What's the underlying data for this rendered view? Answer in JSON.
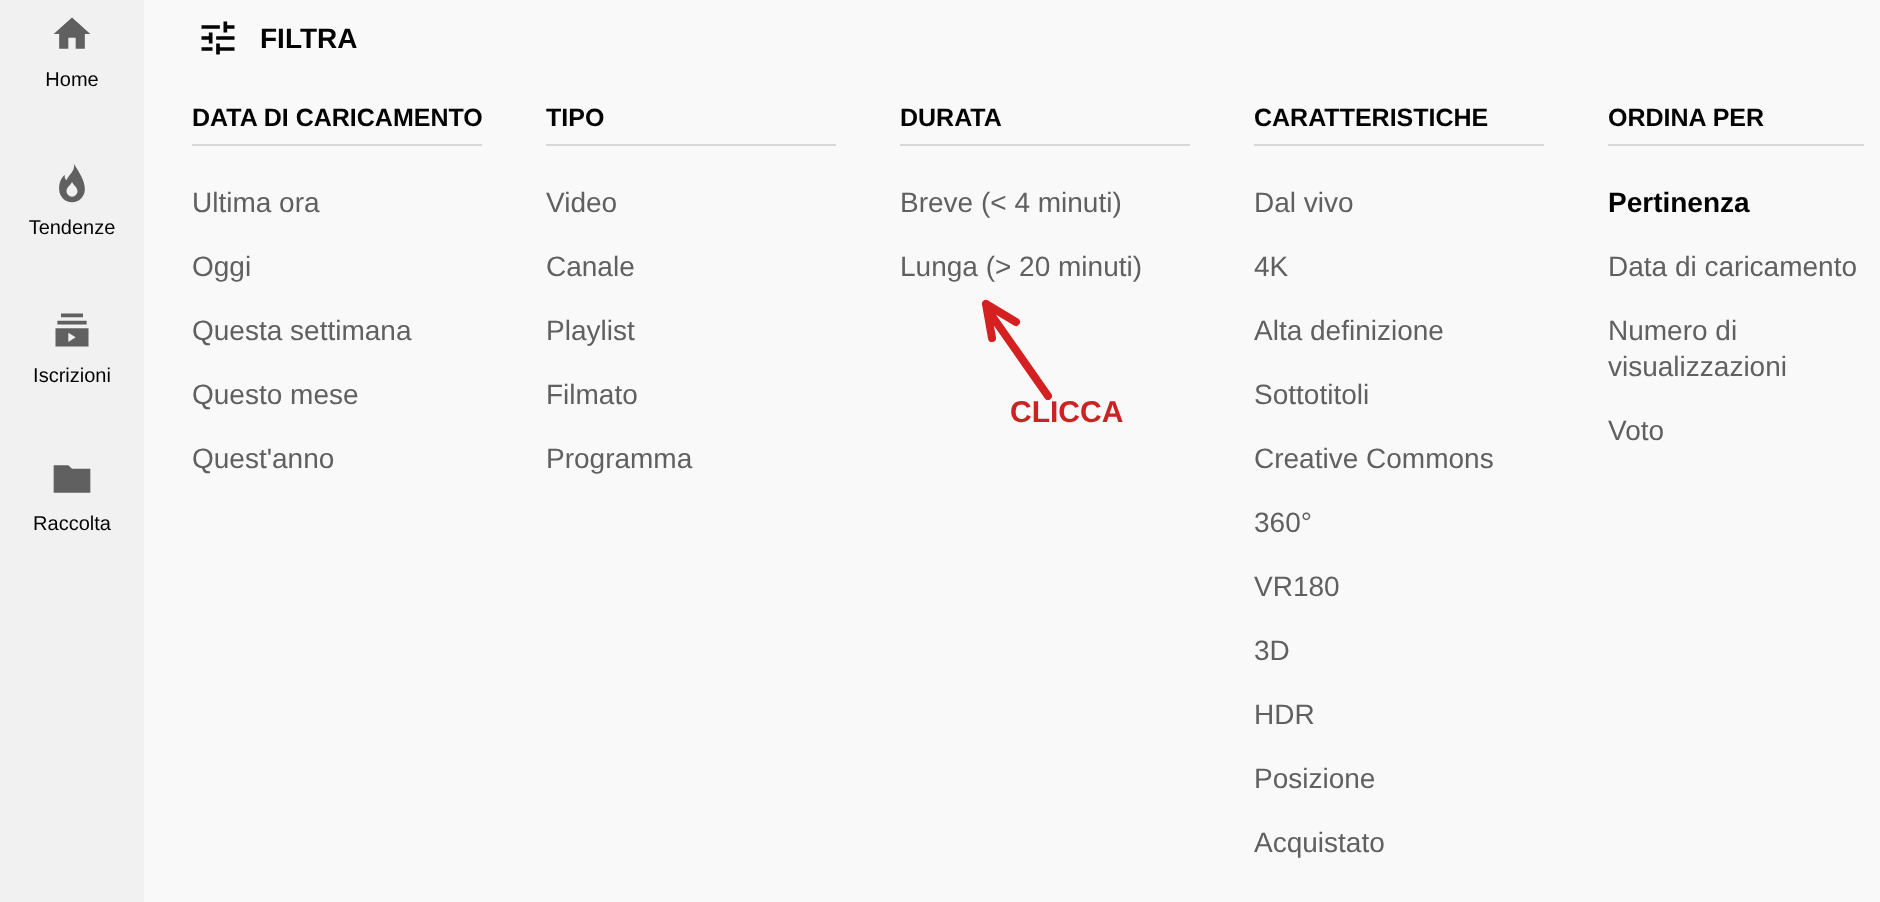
{
  "sidebar": {
    "items": [
      {
        "label": "Home"
      },
      {
        "label": "Tendenze"
      },
      {
        "label": "Iscrizioni"
      },
      {
        "label": "Raccolta"
      }
    ]
  },
  "header": {
    "title": "FILTRA"
  },
  "filter_groups": [
    {
      "heading": "DATA DI CARICAMENTO",
      "options": [
        {
          "label": "Ultima ora",
          "selected": false
        },
        {
          "label": "Oggi",
          "selected": false
        },
        {
          "label": "Questa settimana",
          "selected": false
        },
        {
          "label": "Questo mese",
          "selected": false
        },
        {
          "label": "Quest'anno",
          "selected": false
        }
      ]
    },
    {
      "heading": "TIPO",
      "options": [
        {
          "label": "Video",
          "selected": false
        },
        {
          "label": "Canale",
          "selected": false
        },
        {
          "label": "Playlist",
          "selected": false
        },
        {
          "label": "Filmato",
          "selected": false
        },
        {
          "label": "Programma",
          "selected": false
        }
      ]
    },
    {
      "heading": "DURATA",
      "options": [
        {
          "label": "Breve (< 4 minuti)",
          "selected": false
        },
        {
          "label": "Lunga (> 20 minuti)",
          "selected": false
        }
      ]
    },
    {
      "heading": "CARATTERISTICHE",
      "options": [
        {
          "label": "Dal vivo",
          "selected": false
        },
        {
          "label": "4K",
          "selected": false
        },
        {
          "label": "Alta definizione",
          "selected": false
        },
        {
          "label": "Sottotitoli",
          "selected": false
        },
        {
          "label": "Creative Commons",
          "selected": false
        },
        {
          "label": "360°",
          "selected": false
        },
        {
          "label": "VR180",
          "selected": false
        },
        {
          "label": "3D",
          "selected": false
        },
        {
          "label": "HDR",
          "selected": false
        },
        {
          "label": "Posizione",
          "selected": false
        },
        {
          "label": "Acquistato",
          "selected": false
        }
      ]
    },
    {
      "heading": "ORDINA PER",
      "options": [
        {
          "label": "Pertinenza",
          "selected": true
        },
        {
          "label": "Data di caricamento",
          "selected": false
        },
        {
          "label": "Numero di visualizzazioni",
          "selected": false
        },
        {
          "label": "Voto",
          "selected": false
        }
      ]
    }
  ],
  "annotation": {
    "text": "CLICCA"
  }
}
